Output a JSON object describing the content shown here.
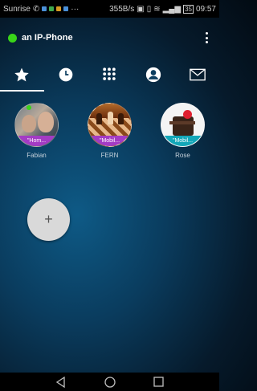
{
  "status_bar": {
    "carrier": "Sunrise",
    "speed": "355B/s",
    "battery": "35",
    "time": "09:57"
  },
  "app_bar": {
    "title": "an IP-Phone",
    "status_color": "#39d419"
  },
  "tabs": [
    {
      "icon": "star-icon",
      "active": true
    },
    {
      "icon": "clock-icon",
      "active": false
    },
    {
      "icon": "dialpad-icon",
      "active": false
    },
    {
      "icon": "contact-icon",
      "active": false
    },
    {
      "icon": "mail-icon",
      "active": false
    }
  ],
  "favorites": [
    {
      "name": "Fabian",
      "tag": "\"Hom...",
      "tag_color": "#a33bc4"
    },
    {
      "name": "FERN",
      "tag": "\"Mobil...",
      "tag_color": "#a33bc4"
    },
    {
      "name": "Rose",
      "tag": "\"Mobil...",
      "tag_color": "#13a7b8"
    }
  ],
  "add_button": {
    "label": "+"
  }
}
